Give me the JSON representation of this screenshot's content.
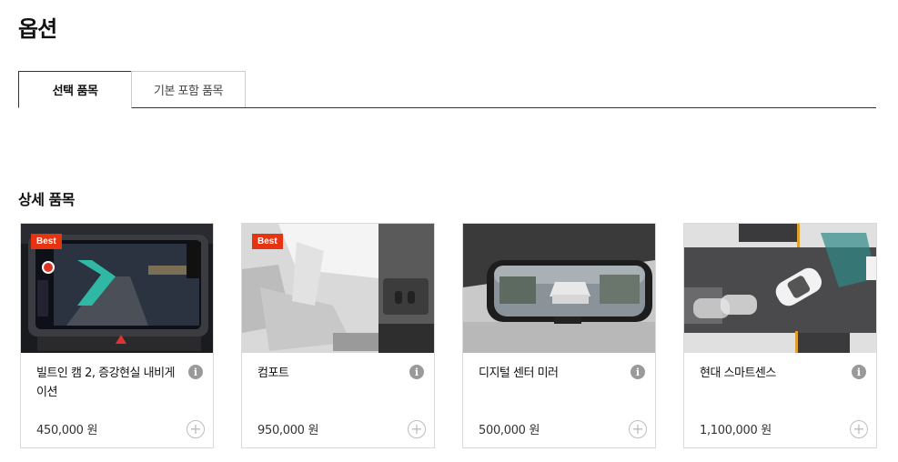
{
  "page": {
    "title": "옵션"
  },
  "tabs": [
    {
      "label": "선택 품목",
      "active": true
    },
    {
      "label": "기본 포함 품목",
      "active": false
    }
  ],
  "section": {
    "title": "상세 품목"
  },
  "cards": [
    {
      "name": "빌트인 캠 2, 증강현실 내비게이션",
      "price": "450,000 원",
      "badge": "Best",
      "icon": "info-icon",
      "add_icon": "plus-icon"
    },
    {
      "name": "컴포트",
      "price": "950,000 원",
      "badge": "Best",
      "icon": "info-icon",
      "add_icon": "plus-icon"
    },
    {
      "name": "디지털 센터 미러",
      "price": "500,000 원",
      "badge": "",
      "icon": "info-icon",
      "add_icon": "plus-icon"
    },
    {
      "name": "현대 스마트센스",
      "price": "1,100,000 원",
      "badge": "",
      "icon": "info-icon",
      "add_icon": "plus-icon"
    }
  ],
  "colors": {
    "badge": "#e63312",
    "tab_border": "#333333",
    "card_border": "#d9d9d9"
  }
}
